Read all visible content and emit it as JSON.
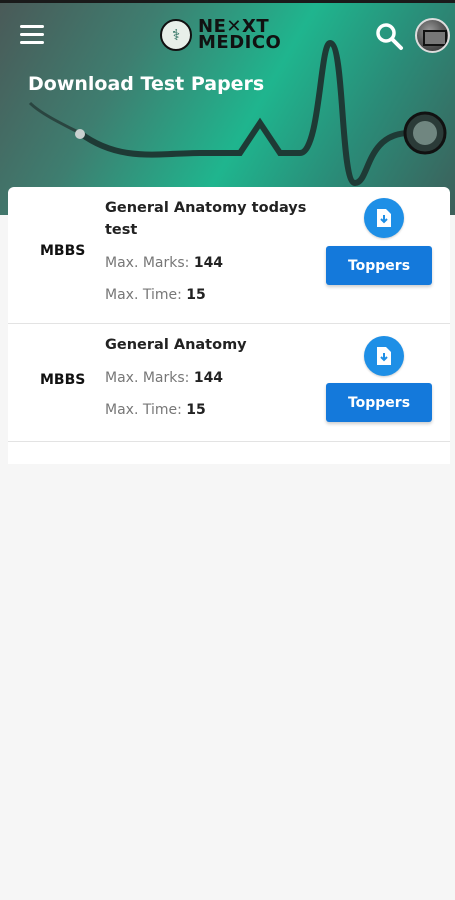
{
  "header": {
    "logo_text_line1": "NE✕XT",
    "logo_text_line2": "MEDICO",
    "page_title": "Download Test Papers"
  },
  "colors": {
    "accent": "#1479db",
    "download_button": "#1e8fe6",
    "hero_green": "#1fb58e"
  },
  "tests": [
    {
      "course": "MBBS",
      "title": "General Anatomy  todays test",
      "marks_label": "Max. Marks: ",
      "marks_value": "144",
      "time_label": "Max. Time: ",
      "time_value": "15",
      "toppers_label": "Toppers",
      "download_icon": "file-download-icon"
    },
    {
      "course": "MBBS",
      "title": "General Anatomy",
      "marks_label": "Max. Marks: ",
      "marks_value": "144",
      "time_label": "Max. Time: ",
      "time_value": "15",
      "toppers_label": "Toppers",
      "download_icon": "file-download-icon"
    }
  ]
}
